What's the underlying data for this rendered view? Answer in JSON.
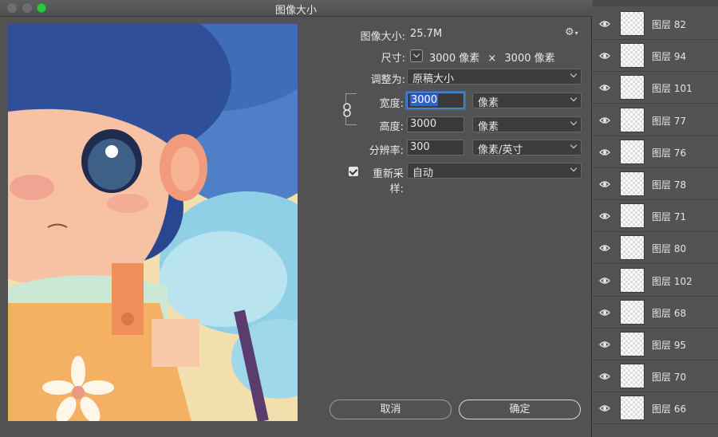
{
  "window": {
    "title": "图像大小"
  },
  "form": {
    "image_size_label": "图像大小:",
    "image_size_value": "25.7M",
    "dimensions_label": "尺寸:",
    "dimensions_width": "3000 像素",
    "dimensions_sep": "×",
    "dimensions_height": "3000 像素",
    "fit_to_label": "调整为:",
    "fit_to_value": "原稿大小",
    "width_label": "宽度:",
    "width_value": "3000",
    "width_unit": "像素",
    "height_label": "高度:",
    "height_value": "3000",
    "height_unit": "像素",
    "resolution_label": "分辨率:",
    "resolution_value": "300",
    "resolution_unit": "像素/英寸",
    "resample_label": "重新采样:",
    "resample_checked": true,
    "resample_value": "自动"
  },
  "buttons": {
    "cancel": "取消",
    "ok": "确定"
  },
  "icons": {
    "settings": "gear-icon",
    "link": "chain-link-icon",
    "visibility": "eye-icon"
  },
  "colors": {
    "focus": "#2f63c8",
    "zoom_button": "#2fc840",
    "panel_bg": "#535353"
  },
  "layers": [
    {
      "name": "图层 82"
    },
    {
      "name": "图层 94"
    },
    {
      "name": "图层 101"
    },
    {
      "name": "图层 77"
    },
    {
      "name": "图层 76"
    },
    {
      "name": "图层 78"
    },
    {
      "name": "图层 71"
    },
    {
      "name": "图层 80"
    },
    {
      "name": "图层 102"
    },
    {
      "name": "图层 68"
    },
    {
      "name": "图层 95"
    },
    {
      "name": "图层 70"
    },
    {
      "name": "图层 66"
    }
  ]
}
